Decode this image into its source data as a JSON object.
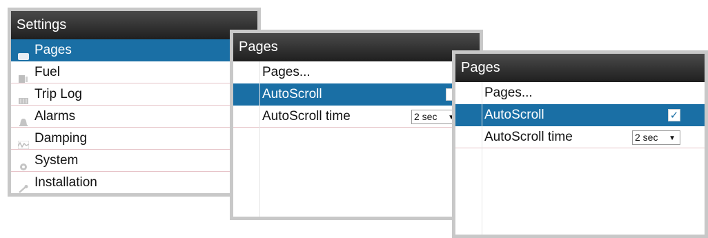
{
  "settings": {
    "title": "Settings",
    "items": [
      {
        "label": "Pages",
        "icon": "pages-icon",
        "selected": true
      },
      {
        "label": "Fuel",
        "icon": "fuel-icon",
        "selected": false
      },
      {
        "label": "Trip Log",
        "icon": "trip-log-icon",
        "selected": false
      },
      {
        "label": "Alarms",
        "icon": "alarm-bell-icon",
        "selected": false
      },
      {
        "label": "Damping",
        "icon": "damping-icon",
        "selected": false
      },
      {
        "label": "System",
        "icon": "system-gear-icon",
        "selected": false
      },
      {
        "label": "Installation",
        "icon": "wrench-icon",
        "selected": false
      }
    ]
  },
  "pages_before": {
    "title": "Pages",
    "pages_item": "Pages...",
    "autoscroll_label": "AutoScroll",
    "autoscroll_checked": false,
    "autoscroll_time_label": "AutoScroll time",
    "autoscroll_time_value": "2 sec"
  },
  "pages_after": {
    "title": "Pages",
    "pages_item": "Pages...",
    "autoscroll_label": "AutoScroll",
    "autoscroll_checked": true,
    "autoscroll_check_glyph": "✓",
    "autoscroll_time_label": "AutoScroll time",
    "autoscroll_time_value": "2 sec",
    "dropdown_caret": "▼"
  },
  "colors": {
    "selection": "#1a6fa5",
    "titlebar_top": "#4a4a4a",
    "titlebar_bottom": "#1f1f1f",
    "separator": "#e6c3c8",
    "panel_border": "#c8c8c8"
  }
}
